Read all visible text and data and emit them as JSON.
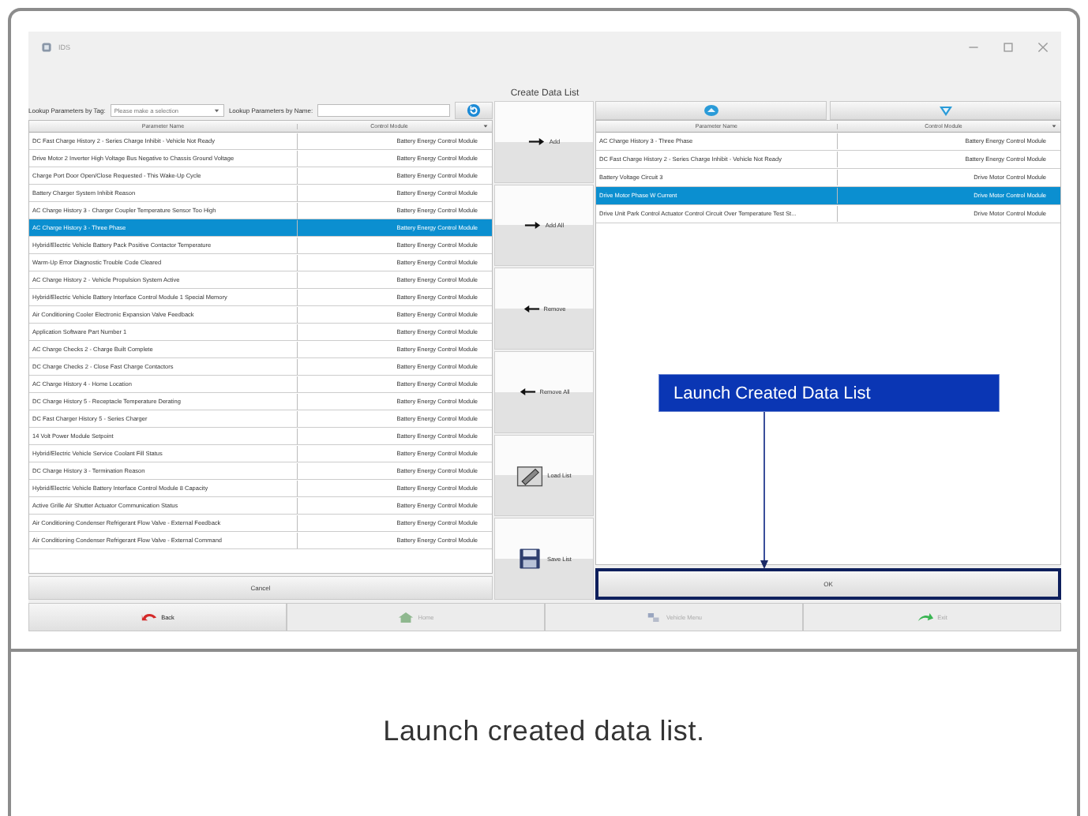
{
  "window": {
    "title": "IDS",
    "heading": "Create Data List"
  },
  "lookup": {
    "tag_label": "Lookup Parameters by Tag:",
    "tag_placeholder": "Please make a selection",
    "name_label": "Lookup Parameters by Name:"
  },
  "available": {
    "columns": [
      "Parameter Name",
      "Control Module"
    ],
    "rows": [
      {
        "name": "DC Fast Charge History 2 - Series Charge Inhibit - Vehicle Not Ready",
        "module": "Battery Energy Control Module",
        "selected": false
      },
      {
        "name": "Drive Motor 2 Inverter High Voltage Bus Negative to Chassis Ground Voltage",
        "module": "Battery Energy Control Module",
        "selected": false
      },
      {
        "name": "Charge Port Door Open/Close Requested - This Wake-Up Cycle",
        "module": "Battery Energy Control Module",
        "selected": false
      },
      {
        "name": "Battery Charger System Inhibit Reason",
        "module": "Battery Energy Control Module",
        "selected": false
      },
      {
        "name": "AC Charge History 3 - Charger Coupler Temperature Sensor Too High",
        "module": "Battery Energy Control Module",
        "selected": false
      },
      {
        "name": "AC Charge History 3 - Three Phase",
        "module": "Battery Energy Control Module",
        "selected": true
      },
      {
        "name": "Hybrid/Electric Vehicle Battery Pack Positive Contactor Temperature",
        "module": "Battery Energy Control Module",
        "selected": false
      },
      {
        "name": "Warm-Up Error Diagnostic Trouble Code Cleared",
        "module": "Battery Energy Control Module",
        "selected": false
      },
      {
        "name": "AC Charge History 2 - Vehicle Propulsion System Active",
        "module": "Battery Energy Control Module",
        "selected": false
      },
      {
        "name": "Hybrid/Electric Vehicle Battery Interface Control Module 1 Special Memory",
        "module": "Battery Energy Control Module",
        "selected": false
      },
      {
        "name": "Air Conditioning Cooler Electronic Expansion Valve Feedback",
        "module": "Battery Energy Control Module",
        "selected": false
      },
      {
        "name": "Application Software Part Number 1",
        "module": "Battery Energy Control Module",
        "selected": false
      },
      {
        "name": "AC Charge Checks 2 - Charge Built Complete",
        "module": "Battery Energy Control Module",
        "selected": false
      },
      {
        "name": "DC Charge Checks 2 - Close Fast Charge Contactors",
        "module": "Battery Energy Control Module",
        "selected": false
      },
      {
        "name": "AC Charge History 4 - Home Location",
        "module": "Battery Energy Control Module",
        "selected": false
      },
      {
        "name": "DC Charge History 5 - Receptacle Temperature Derating",
        "module": "Battery Energy Control Module",
        "selected": false
      },
      {
        "name": "DC Fast Charger History 5 - Series Charger",
        "module": "Battery Energy Control Module",
        "selected": false
      },
      {
        "name": "14 Volt Power Module Setpoint",
        "module": "Battery Energy Control Module",
        "selected": false
      },
      {
        "name": "Hybrid/Electric Vehicle Service Coolant Fill Status",
        "module": "Battery Energy Control Module",
        "selected": false
      },
      {
        "name": "DC Charge History 3 - Termination Reason",
        "module": "Battery Energy Control Module",
        "selected": false
      },
      {
        "name": "Hybrid/Electric Vehicle Battery Interface Control Module 8 Capacity",
        "module": "Battery Energy Control Module",
        "selected": false
      },
      {
        "name": "Active Grille Air Shutter Actuator Communication Status",
        "module": "Battery Energy Control Module",
        "selected": false
      },
      {
        "name": "Air Conditioning Condenser Refrigerant Flow Valve - External Feedback",
        "module": "Battery Energy Control Module",
        "selected": false
      },
      {
        "name": "Air Conditioning Condenser Refrigerant Flow Valve - External Command",
        "module": "Battery Energy Control Module",
        "selected": false
      }
    ]
  },
  "actions": [
    {
      "label": "Add",
      "kind": "add"
    },
    {
      "label": "Add All",
      "kind": "add_all"
    },
    {
      "label": "Remove",
      "kind": "remove"
    },
    {
      "label": "Remove All",
      "kind": "remove_all"
    },
    {
      "label": "Load List",
      "kind": "load"
    },
    {
      "label": "Save List",
      "kind": "save"
    }
  ],
  "cancel": "Cancel",
  "chosen": {
    "columns": [
      "Parameter Name",
      "Control Module"
    ],
    "rows": [
      {
        "name": "AC Charge History 3 - Three Phase",
        "module": "Battery Energy Control Module",
        "selected": false
      },
      {
        "name": "DC Fast Charge History 2 - Series Charge Inhibit - Vehicle Not Ready",
        "module": "Battery Energy Control Module",
        "selected": false
      },
      {
        "name": "Battery Voltage Circuit 3",
        "module": "Drive Motor Control Module",
        "selected": false
      },
      {
        "name": "Drive Motor Phase W Current",
        "module": "Drive Motor Control Module",
        "selected": true
      },
      {
        "name": "Drive Unit Park Control Actuator Control Circuit Over Temperature Test St...",
        "module": "Drive Motor Control Module",
        "selected": false
      }
    ]
  },
  "ok": "OK",
  "callout": "Launch Created Data List",
  "nav": [
    {
      "label": "Back",
      "kind": "back",
      "disabled": false
    },
    {
      "label": "Home",
      "kind": "home",
      "disabled": true
    },
    {
      "label": "Vehicle Menu",
      "kind": "vehicle",
      "disabled": true
    },
    {
      "label": "Exit",
      "kind": "exit",
      "disabled": true
    }
  ],
  "caption": "Launch created data list."
}
